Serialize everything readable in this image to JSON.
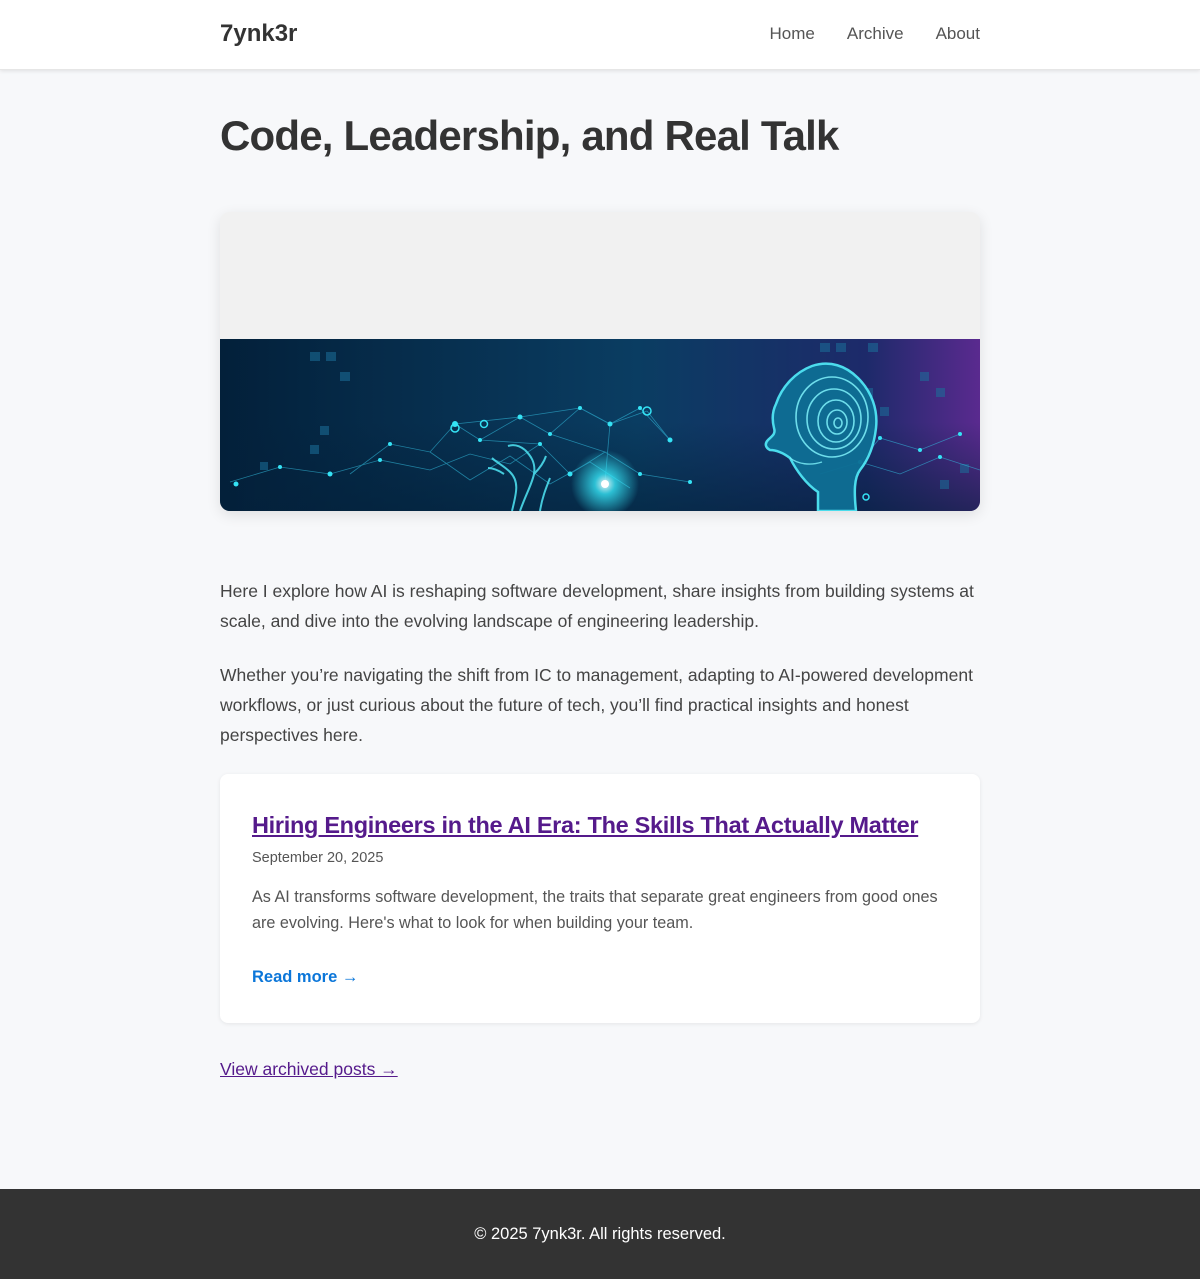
{
  "site": {
    "brand": "7ynk3r"
  },
  "nav": [
    {
      "label": "Home"
    },
    {
      "label": "Archive"
    },
    {
      "label": "About"
    }
  ],
  "hero": {
    "title": "Code, Leadership, and Real Talk"
  },
  "banner": {
    "colors": {
      "deep": "#03203a",
      "mid": "#0a3d62",
      "purple": "#5a2a8f",
      "glow": "#35e3f5"
    }
  },
  "intro": {
    "p1": "Here I explore how AI is reshaping software development, share insights from building systems at scale, and dive into the evolving landscape of engineering leadership.",
    "p2": "Whether you’re navigating the shift from IC to management, adapting to AI-powered development workflows, or just curious about the future of tech, you’ll find practical insights and honest perspectives here."
  },
  "post": {
    "title": "Hiring Engineers in the AI Era: The Skills That Actually Matter",
    "date": "September 20, 2025",
    "excerpt": "As AI transforms software development, the traits that separate great engineers from good ones are evolving. Here's what to look for when building your team.",
    "read_more": "Read more →"
  },
  "archive_link": "View archived posts →",
  "footer": {
    "text": "© 2025 7ynk3r. All rights reserved."
  }
}
